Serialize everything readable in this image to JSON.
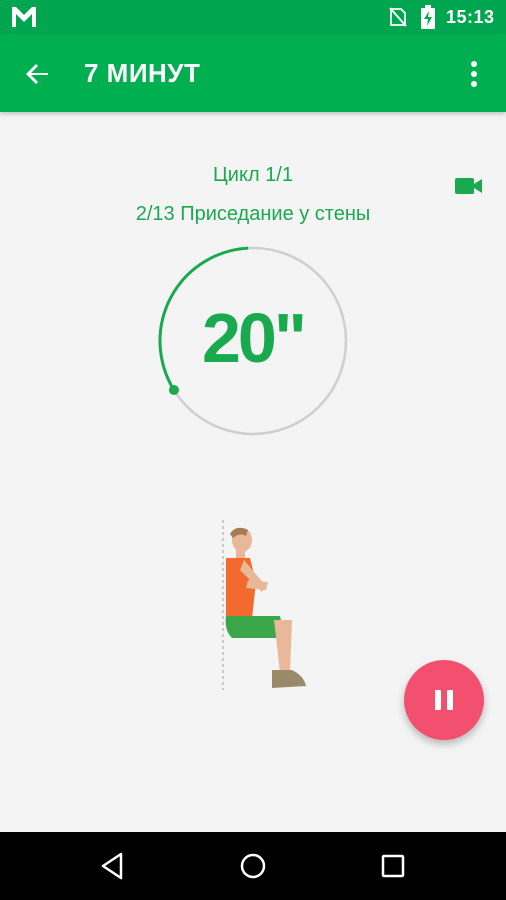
{
  "status_bar": {
    "time": "15:13",
    "icons": [
      "gmail-icon",
      "no-sim-icon",
      "battery-charging-icon"
    ]
  },
  "app_bar": {
    "title": "7 МИНУТ",
    "back_icon": "arrow-back-icon",
    "menu_icon": "more-vert-icon"
  },
  "workout": {
    "cycle_text": "Цикл 1/1",
    "exercise_text": "2/13 Приседание у стены",
    "timer_value": "20\"",
    "timer_progress": 0.33,
    "video_icon": "videocam-icon"
  },
  "fab": {
    "icon": "pause-icon"
  },
  "nav_bar": {
    "icons": [
      "nav-back-icon",
      "nav-home-icon",
      "nav-recents-icon"
    ]
  },
  "colors": {
    "status_bar": "#00a64f",
    "app_bar": "#00b050",
    "accent_green": "#19a94e",
    "fab": "#f35070",
    "background": "#f4f4f4",
    "ring_track": "#cfcfcf"
  }
}
